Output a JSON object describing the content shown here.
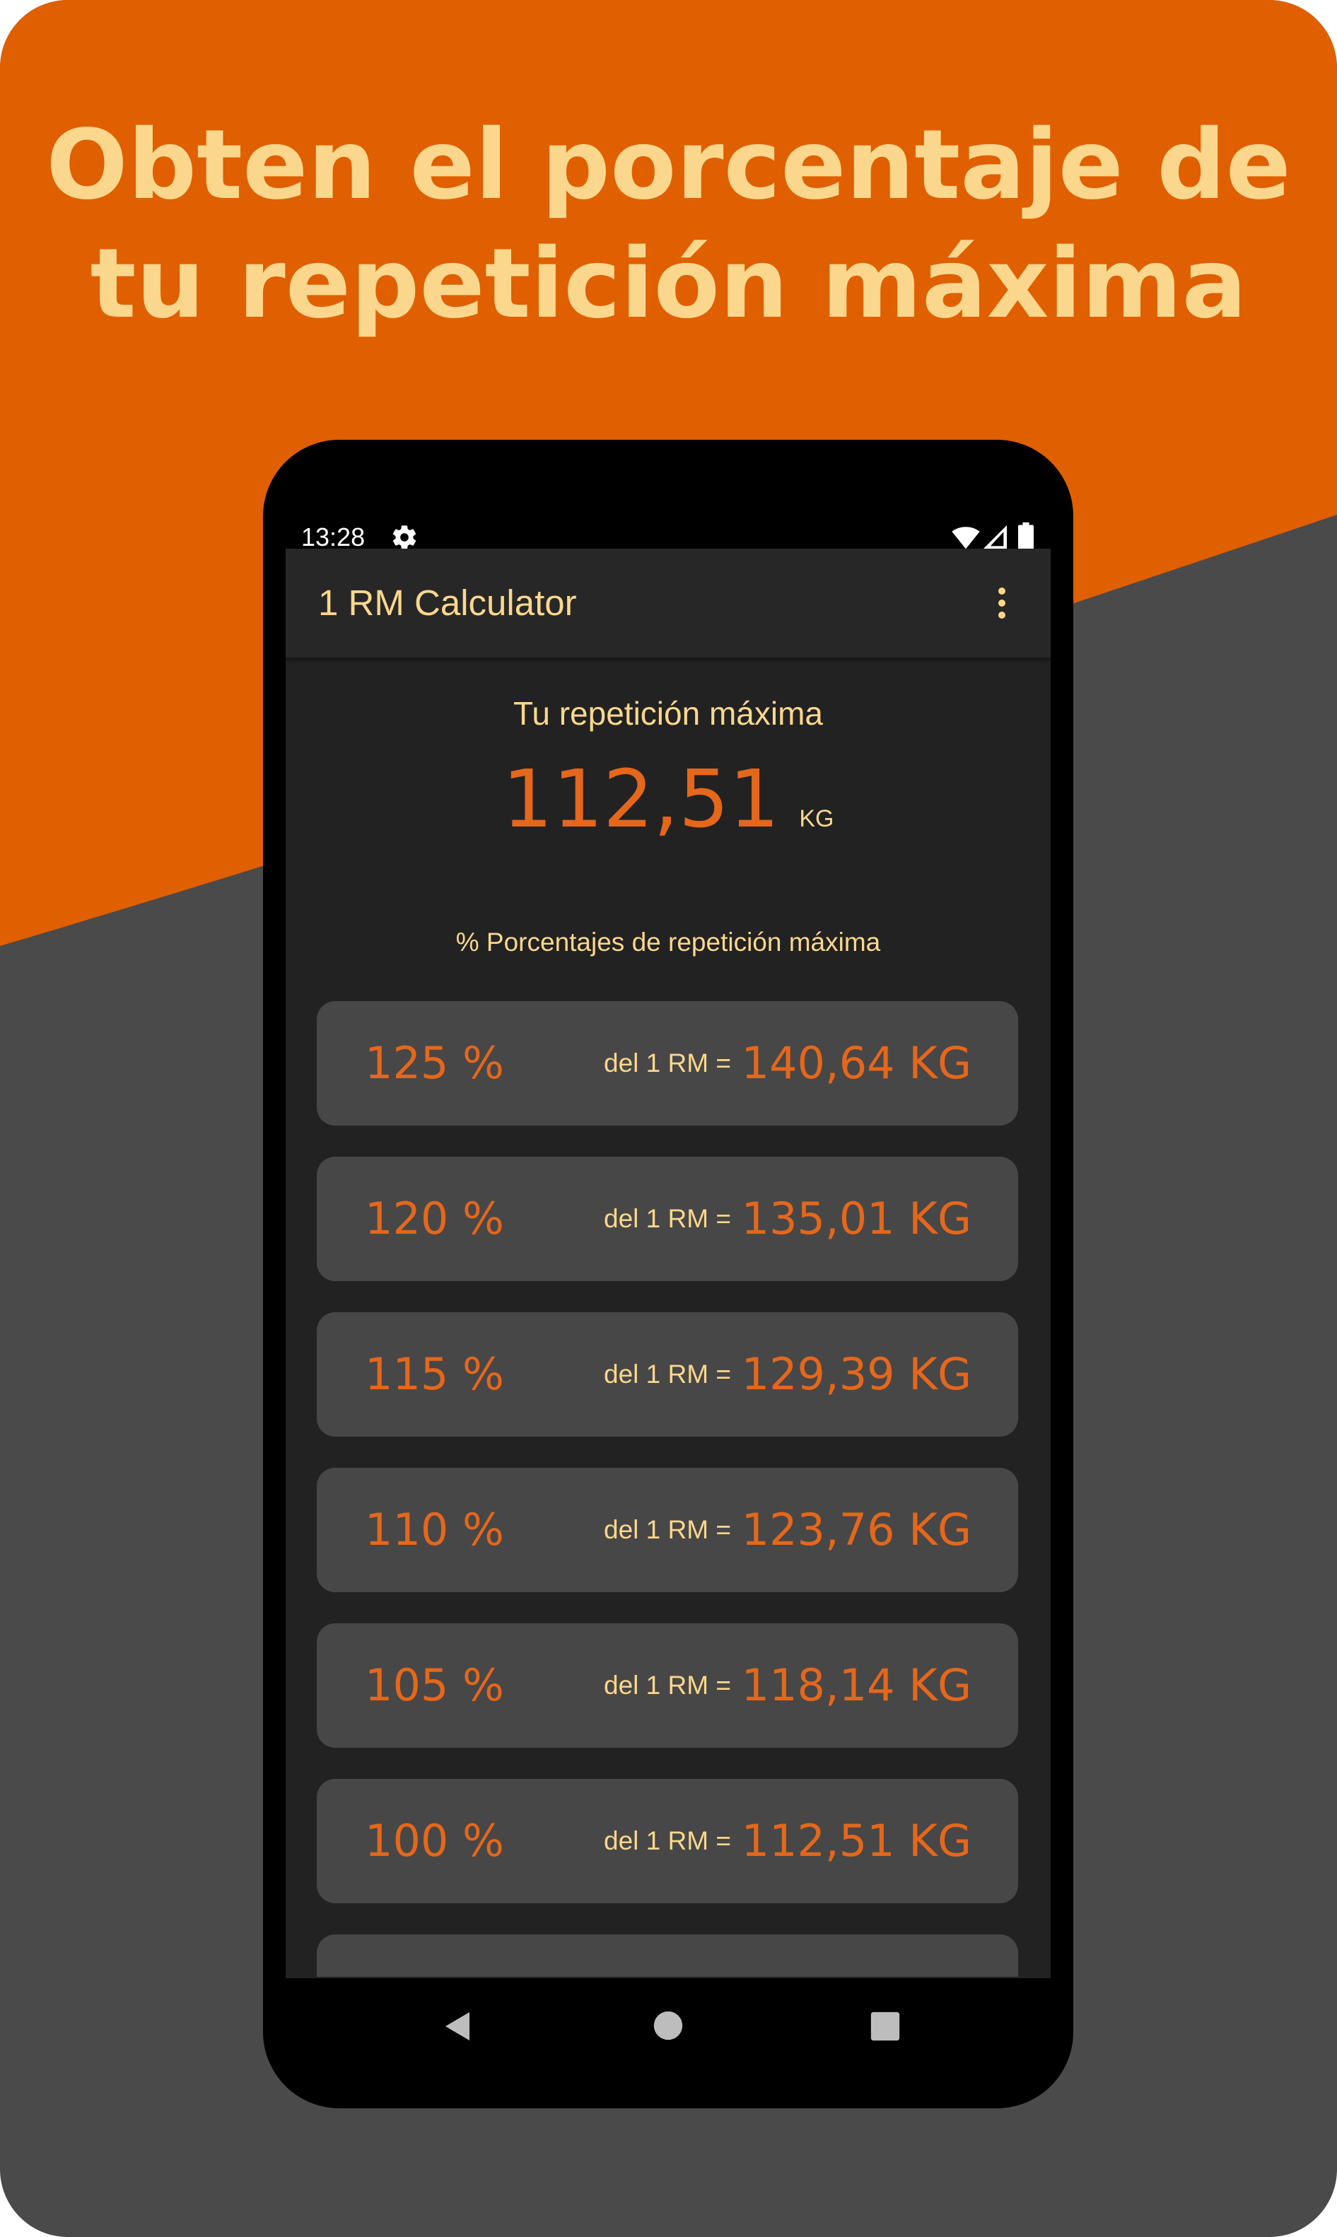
{
  "headline": {
    "line1": "Obten el porcentaje de",
    "line2": "tu repetición máxima"
  },
  "colors": {
    "orange": "#e05f00",
    "dark_gray": "#4a4a4a",
    "cream": "#fbd78d",
    "accent_text": "#e5671b",
    "row_bg": "#474747",
    "app_bg": "#222222"
  },
  "status_bar": {
    "time": "13:28",
    "icons": [
      "gear-icon",
      "wifi-icon",
      "signal-icon",
      "battery-icon"
    ]
  },
  "toolbar": {
    "title": "1 RM Calculator",
    "menu_icon": "more-vert-icon"
  },
  "rm": {
    "label": "Tu repetición máxima",
    "value": "112,51",
    "unit": "KG"
  },
  "percentages": {
    "header": "% Porcentajes de repetición máxima",
    "rows": [
      {
        "pct": "125 %",
        "mid": "del 1 RM =",
        "kg": "140,64 KG"
      },
      {
        "pct": "120 %",
        "mid": "del 1 RM =",
        "kg": "135,01 KG"
      },
      {
        "pct": "115 %",
        "mid": "del 1 RM =",
        "kg": "129,39 KG"
      },
      {
        "pct": "110 %",
        "mid": "del 1 RM =",
        "kg": "123,76 KG"
      },
      {
        "pct": "105 %",
        "mid": "del 1 RM =",
        "kg": "118,14 KG"
      },
      {
        "pct": "100 %",
        "mid": "del 1 RM =",
        "kg": "112,51 KG"
      }
    ]
  },
  "nav_bar": {
    "icons": [
      "back-icon",
      "home-icon",
      "recents-icon"
    ]
  }
}
